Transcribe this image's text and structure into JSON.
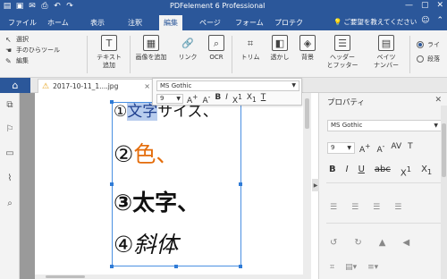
{
  "app": {
    "title": "PDFelement 6 Professional"
  },
  "quick_access": [
    {
      "name": "pdf-file-icon",
      "glyph": "▤"
    },
    {
      "name": "save-icon",
      "glyph": "▣"
    },
    {
      "name": "mail-icon",
      "glyph": "✉"
    },
    {
      "name": "print-icon",
      "glyph": "⎙"
    },
    {
      "name": "undo-icon",
      "glyph": "↶"
    },
    {
      "name": "redo-icon",
      "glyph": "↷"
    }
  ],
  "window_controls": {
    "minimize": "—",
    "restore": "▢",
    "close": "✕"
  },
  "tabs": [
    "ファイル",
    "ホーム",
    "表示",
    "注釈",
    "編集",
    "ページ",
    "フォーム",
    "プロテク"
  ],
  "active_tab": "編集",
  "help_hint": "ご要望を教えてください",
  "ribbon": {
    "select": "選択",
    "hand": "手のひらツール",
    "edit": "編集",
    "text_add": "テキスト\n追加",
    "image_add": "画像を追加",
    "link": "リンク",
    "ocr": "OCR",
    "trim": "トリム",
    "watermark": "透かし",
    "background": "背景",
    "header_footer": "ヘッダー\nとフッター",
    "bates": "ベイツ\nナンバー",
    "radio_line": "ライ",
    "radio_paragraph": "段落"
  },
  "doc_tab": {
    "filename": "2017-10-11_1....jpg",
    "close": "×"
  },
  "font_toolbar": {
    "font": "MS Gothic",
    "size": "9"
  },
  "document": {
    "line1_num": "①",
    "line1_highlight": "文字",
    "line1_rest": "サイズ、",
    "line2_num": "②",
    "line2_colored": "色、",
    "line3": "③太字、",
    "line4": "④斜体"
  },
  "properties": {
    "title": "プロパティ",
    "font": "MS Gothic",
    "size": "9"
  },
  "colors": {
    "ribbon_blue": "#2b579a",
    "highlight": "#b8cdee",
    "orange_text": "#e46c0a",
    "selection_border": "#4a90e2"
  }
}
